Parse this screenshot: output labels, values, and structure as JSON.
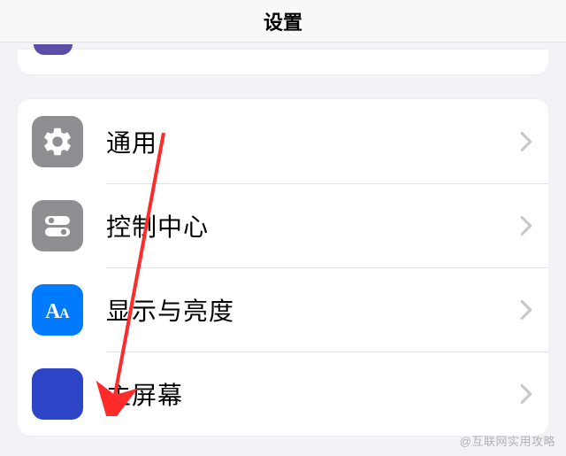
{
  "header": {
    "title": "设置"
  },
  "rows": [
    {
      "id": "general",
      "label": "通用",
      "icon": "gear-icon",
      "icon_bg": "gray"
    },
    {
      "id": "control-center",
      "label": "控制中心",
      "icon": "toggles-icon",
      "icon_bg": "gray"
    },
    {
      "id": "display-brightness",
      "label": "显示与亮度",
      "icon": "text-size-icon",
      "icon_bg": "blue"
    },
    {
      "id": "home-screen",
      "label": "主屏幕",
      "icon": "app-grid-icon",
      "icon_bg": "grid"
    }
  ],
  "annotation": {
    "type": "arrow",
    "color": "#ff2a2a",
    "target_row": "home-screen"
  },
  "watermark": "@互联网实用攻略"
}
